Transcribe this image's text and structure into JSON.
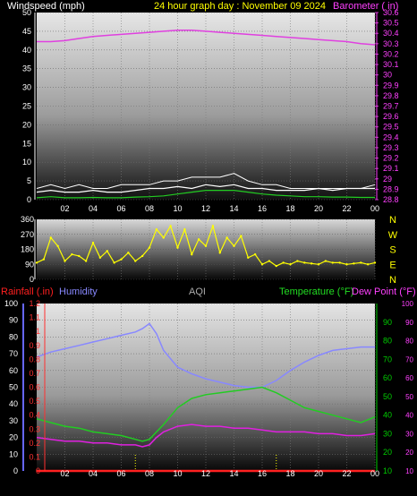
{
  "header": {
    "windspeed": "Windspeed (mph)",
    "title": "24 hour graph day : November 09 2024",
    "barometer": "Barometer ( in)"
  },
  "lower_header": {
    "rainfall": "Rainfall (.in)",
    "humidity": "Humidity",
    "aqi": "AQI",
    "temperature": "Temperature (°F)",
    "dewpoint": "Dew Point (°F)"
  },
  "colors": {
    "windspeed": "#ffffff",
    "gust": "#ffffff",
    "wind_avg": "#22cc22",
    "barometer": "#e040e0",
    "direction": "#ffff00",
    "humidity": "#8888ff",
    "temperature": "#22cc22",
    "dewpoint": "#e020e0",
    "rain": "#ff2020",
    "aqi_text": "#aaaaaa",
    "header_yellow": "#ffff00",
    "axis_green": "#00cc00",
    "axis_blue": "#6666ff",
    "axis_red": "#ff3030"
  },
  "x_ticks": [
    "02",
    "04",
    "06",
    "08",
    "10",
    "12",
    "14",
    "16",
    "18",
    "20",
    "22",
    "00"
  ],
  "direction_labels": [
    "N",
    "W",
    "S",
    "E",
    "N"
  ],
  "chart_data": [
    {
      "type": "line",
      "title": "24 hour graph day : November 09 2024",
      "xlabel": "",
      "xlim": [
        0,
        24
      ],
      "left_axis": {
        "label": "Windspeed (mph)",
        "ylim": [
          0,
          50
        ],
        "ticks": [
          0,
          5,
          10,
          15,
          20,
          25,
          30,
          35,
          40,
          45,
          50
        ]
      },
      "right_axis": {
        "label": "Barometer ( in)",
        "ylim": [
          28.8,
          30.6
        ],
        "ticks": [
          "28.8",
          "28.9",
          "29",
          "29.1",
          "29.2",
          "29.3",
          "29.4",
          "29.5",
          "29.6",
          "29.7",
          "29.8",
          "29.9",
          "30",
          "30.1",
          "30.2",
          "30.3",
          "30.4",
          "30.5",
          "30.6"
        ]
      },
      "series": [
        {
          "name": "Barometer ( in)",
          "axis": "right",
          "x": [
            0,
            1,
            2,
            3,
            4,
            5,
            6,
            7,
            8,
            9,
            10,
            11,
            12,
            13,
            14,
            15,
            16,
            17,
            18,
            19,
            20,
            21,
            22,
            23,
            24
          ],
          "values": [
            30.32,
            30.32,
            30.33,
            30.35,
            30.37,
            30.38,
            30.39,
            30.4,
            30.41,
            30.42,
            30.43,
            30.43,
            30.42,
            30.41,
            30.4,
            30.39,
            30.38,
            30.37,
            30.36,
            30.35,
            30.34,
            30.33,
            30.32,
            30.3,
            30.29
          ]
        },
        {
          "axis": "left",
          "x": [
            0,
            1,
            2,
            3,
            4,
            5,
            6,
            7,
            8,
            9,
            10,
            11,
            12,
            13,
            14,
            15,
            16,
            17,
            18,
            19,
            20,
            21,
            22,
            23,
            24
          ],
          "values": [
            2,
            2.5,
            2,
            2,
            2.5,
            2,
            2,
            2.5,
            3,
            3,
            3.5,
            3,
            4,
            3.5,
            4,
            3,
            3,
            2.5,
            2.5,
            2.5,
            3,
            2.5,
            3,
            3,
            3
          ]
        },
        {
          "axis": "left",
          "x": [
            0,
            1,
            2,
            3,
            4,
            5,
            6,
            7,
            8,
            9,
            10,
            11,
            12,
            13,
            14,
            15,
            16,
            17,
            18,
            19,
            20,
            21,
            22,
            23,
            24
          ],
          "values": [
            3,
            4,
            3,
            4,
            3,
            3,
            4,
            4,
            4,
            5,
            5,
            6,
            6,
            6,
            7,
            5,
            4,
            4,
            3,
            3,
            3,
            3,
            3,
            3,
            4
          ]
        },
        {
          "axis": "left",
          "x": [
            0,
            1,
            2,
            3,
            4,
            5,
            6,
            7,
            8,
            9,
            10,
            11,
            12,
            13,
            14,
            15,
            16,
            17,
            18,
            19,
            20,
            21,
            22,
            23,
            24
          ],
          "values": [
            0.5,
            0.8,
            0.5,
            0.5,
            0.6,
            0.5,
            0.5,
            0.7,
            0.8,
            1,
            1.5,
            2,
            2.5,
            2.5,
            2.5,
            2,
            1.5,
            1.2,
            1,
            0.8,
            0.8,
            0.7,
            0.7,
            0.6,
            0.6
          ]
        }
      ]
    },
    {
      "type": "scatter",
      "xlim": [
        0,
        24
      ],
      "left_axis": {
        "ylim": [
          0,
          360
        ],
        "ticks": [
          0,
          90,
          180,
          270,
          360
        ]
      },
      "right_axis": {
        "labels": [
          "N",
          "W",
          "S",
          "E",
          "N"
        ]
      },
      "series": [
        {
          "axis": "left",
          "x": [
            0,
            0.5,
            1,
            1.5,
            2,
            2.5,
            3,
            3.5,
            4,
            4.5,
            5,
            5.5,
            6,
            6.5,
            7,
            7.5,
            8,
            8.5,
            9,
            9.5,
            10,
            10.5,
            11,
            11.5,
            12,
            12.5,
            13,
            13.5,
            14,
            14.5,
            15,
            15.5,
            16,
            16.5,
            17,
            17.5,
            18,
            18.5,
            19,
            19.5,
            20,
            20.5,
            21,
            21.5,
            22,
            22.5,
            23,
            23.5,
            24
          ],
          "values": [
            100,
            120,
            250,
            200,
            110,
            150,
            140,
            110,
            220,
            130,
            170,
            100,
            120,
            160,
            110,
            140,
            190,
            300,
            250,
            320,
            190,
            300,
            150,
            240,
            200,
            320,
            160,
            250,
            200,
            260,
            130,
            150,
            90,
            110,
            80,
            100,
            90,
            110,
            100,
            95,
            90,
            110,
            100,
            100,
            90,
            95,
            100,
            90,
            100
          ]
        }
      ]
    },
    {
      "type": "line",
      "xlim": [
        0,
        24
      ],
      "axes": {
        "humidity": {
          "label": "Humidity",
          "ylim": [
            0,
            100
          ],
          "ticks": [
            0,
            10,
            20,
            30,
            40,
            50,
            60,
            70,
            80,
            90,
            100
          ]
        },
        "rainfall": {
          "label": "Rainfall (.in)",
          "ylim": [
            0,
            1.2
          ],
          "ticks": [
            "0",
            "0.1",
            "0.2",
            "0.3",
            "0.4",
            "0.5",
            "0.6",
            "0.7",
            "0.8",
            "0.9",
            "1",
            "1.1",
            "1.2"
          ]
        },
        "temperature": {
          "label": "Temperature (°F)",
          "ylim": [
            10,
            100
          ],
          "ticks": [
            10,
            20,
            30,
            40,
            50,
            60,
            70,
            80,
            90
          ]
        },
        "dewpoint": {
          "label": "Dew Point (°F)",
          "ylim": [
            10,
            100
          ],
          "ticks": [
            10,
            20,
            30,
            40,
            50,
            60,
            70,
            80,
            90,
            100
          ]
        }
      },
      "series": [
        {
          "name": "Humidity",
          "axis": "humidity",
          "x": [
            0,
            1,
            2,
            3,
            4,
            5,
            6,
            7,
            7.5,
            8,
            8.5,
            9,
            10,
            11,
            12,
            13,
            14,
            15,
            16,
            17,
            18,
            19,
            20,
            21,
            22,
            23,
            24
          ],
          "values": [
            68,
            71,
            73,
            75,
            77,
            79,
            81,
            83,
            85,
            88,
            82,
            72,
            62,
            58,
            55,
            53,
            51,
            50,
            50,
            54,
            60,
            65,
            69,
            72,
            73,
            74,
            74
          ]
        },
        {
          "name": "Temperature (°F)",
          "axis": "temperature",
          "x": [
            0,
            1,
            2,
            3,
            4,
            5,
            6,
            7,
            7.5,
            8,
            8.5,
            9,
            10,
            11,
            12,
            13,
            14,
            15,
            16,
            17,
            18,
            19,
            20,
            21,
            22,
            23,
            24
          ],
          "values": [
            38,
            36,
            34,
            33,
            31,
            30,
            29,
            27,
            26,
            27,
            31,
            35,
            44,
            49,
            51,
            52,
            53,
            54,
            55,
            52,
            48,
            44,
            42,
            40,
            38,
            36,
            39
          ]
        },
        {
          "name": "Dew Point (°F)",
          "axis": "dewpoint",
          "x": [
            0,
            1,
            2,
            3,
            4,
            5,
            6,
            7,
            7.5,
            8,
            8.5,
            9,
            10,
            11,
            12,
            13,
            14,
            15,
            16,
            17,
            18,
            19,
            20,
            21,
            22,
            23,
            24
          ],
          "values": [
            28,
            27,
            26,
            26,
            25,
            25,
            24,
            24,
            23,
            24,
            28,
            31,
            34,
            35,
            34,
            34,
            33,
            33,
            32,
            31,
            31,
            31,
            30,
            30,
            29,
            29,
            30
          ]
        },
        {
          "name": "Rainfall (.in)",
          "axis": "rainfall",
          "x": [
            0,
            24
          ],
          "values": [
            0,
            0
          ]
        }
      ]
    }
  ]
}
